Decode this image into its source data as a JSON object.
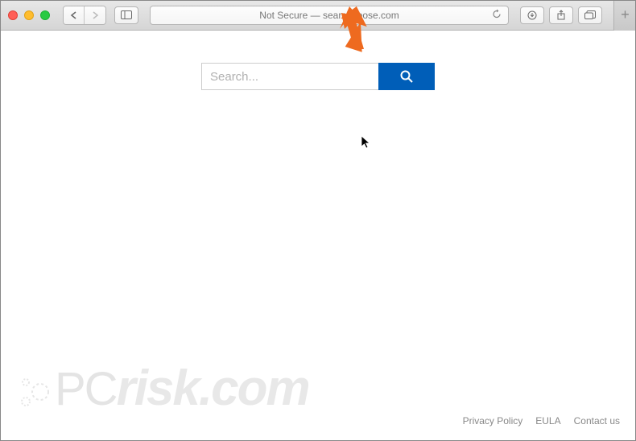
{
  "browser": {
    "address_text": "Not Secure — searchgoose.com",
    "new_tab_glyph": "+"
  },
  "search": {
    "placeholder": "Search..."
  },
  "watermark": {
    "brand_prefix": "PC",
    "brand_suffix": "risk.com"
  },
  "footer": {
    "links": [
      "Privacy Policy",
      "EULA",
      "Contact us"
    ]
  }
}
